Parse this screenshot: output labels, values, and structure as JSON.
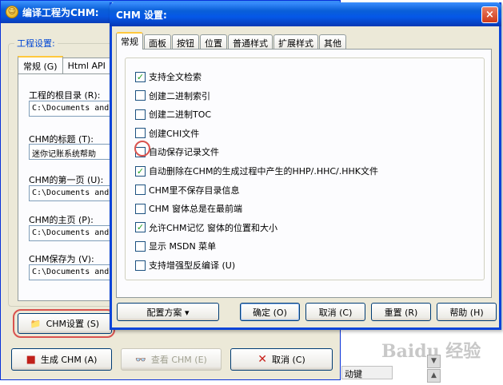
{
  "bg_window": {
    "title": "编译工程为CHM:",
    "group_label": "工程设置:",
    "tabs": [
      "常规 (G)",
      "Html API"
    ],
    "fields": [
      {
        "label": "工程的根目录 (R):",
        "value": "C:\\Documents and"
      },
      {
        "label": "CHM的标题 (T):",
        "value": "迷你记账系统帮助"
      },
      {
        "label": "CHM的第一页 (U):",
        "value": "C:\\Documents and"
      },
      {
        "label": "CHM的主页 (P):",
        "value": "C:\\Documents and"
      },
      {
        "label": "CHM保存为 (V):",
        "value": "C:\\Documents and"
      }
    ],
    "chm_settings_button": "CHM设置 (S)",
    "compile_button": "生成 CHM (A)",
    "view_button": "查看 CHM (E)",
    "cancel_button": "取消 (C)"
  },
  "dialog": {
    "title": "CHM 设置:",
    "close": "×",
    "tabs": [
      "常规",
      "面板",
      "按钮",
      "位置",
      "普通样式",
      "扩展样式",
      "其他"
    ],
    "options": [
      {
        "label": "支持全文检索",
        "checked": true
      },
      {
        "label": "创建二进制索引",
        "checked": false
      },
      {
        "label": "创建二进制TOC",
        "checked": false
      },
      {
        "label": "创建CHI文件",
        "checked": false
      },
      {
        "label": "自动保存记录文件",
        "checked": false
      },
      {
        "label": "自动删除在CHM的生成过程中产生的HHP/.HHC/.HHK文件",
        "checked": true
      },
      {
        "label": "CHM里不保存目录信息",
        "checked": false
      },
      {
        "label": "CHM 窗体总是在最前端",
        "checked": false
      },
      {
        "label": "允许CHM记忆 窗体的位置和大小",
        "checked": true
      },
      {
        "label": "显示 MSDN 菜单",
        "checked": false
      },
      {
        "label": "支持增强型反编译 (U)",
        "checked": false
      }
    ],
    "buttons": {
      "preset": "配置方案 ▾",
      "ok": "确定 (O)",
      "cancel": "取消 (C)",
      "reset": "重置 (R)",
      "help": "帮助 (H)"
    }
  },
  "background_text": {
    "watermark": "Baidu 经验",
    "status_fragment": "动键"
  },
  "colors": {
    "check_green": "#21a121",
    "highlight_red": "#d9534f",
    "xp_blue": "#0a5fd8"
  }
}
